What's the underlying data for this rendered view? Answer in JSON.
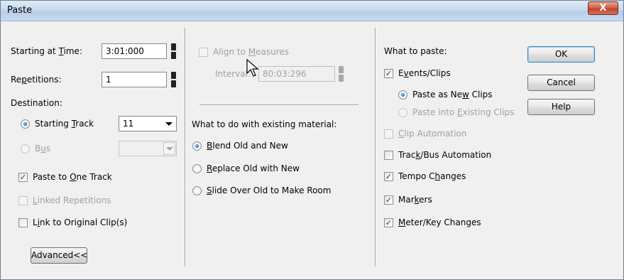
{
  "window": {
    "title": "Paste",
    "close_glyph": "X"
  },
  "left": {
    "starting_time": {
      "label_pre": "Starting at ",
      "label_key": "T",
      "label_post": "ime:",
      "value": "3:01:000"
    },
    "repetitions": {
      "label_pre": "Re",
      "label_key": "p",
      "label_post": "etitions:",
      "value": "1"
    },
    "destination_label": "Destination:",
    "starting_track": {
      "label_pre": "Starting ",
      "label_key": "T",
      "label_post": "rack",
      "value": "11"
    },
    "bus": {
      "label_pre": "B",
      "label_key": "u",
      "label_post": "s",
      "value": ""
    },
    "paste_one_track": {
      "label_pre": "Paste to ",
      "label_key": "O",
      "label_post": "ne Track"
    },
    "linked_reps": {
      "label_pre": "",
      "label_key": "L",
      "label_post": "inked Repetitions"
    },
    "link_original": {
      "label_pre": "L",
      "label_key": "i",
      "label_post": "nk to Original Clip(s)"
    },
    "advanced_button": "Advanced<<"
  },
  "middle": {
    "align_measures": {
      "label_pre": "Align to ",
      "label_key": "M",
      "label_post": "easures"
    },
    "interval": {
      "label": "Interval:",
      "value": "80:03:296"
    },
    "existing_heading": "What to do with existing material:",
    "blend": {
      "label_pre": "",
      "label_key": "B",
      "label_post": "lend Old and New"
    },
    "replace": {
      "label_pre": "",
      "label_key": "R",
      "label_post": "eplace Old with New"
    },
    "slide": {
      "label_pre": "",
      "label_key": "S",
      "label_post": "lide Over Old to Make Room"
    }
  },
  "right": {
    "heading": "What to paste:",
    "events_clips": {
      "label_pre": "E",
      "label_key": "v",
      "label_post": "ents/Clips"
    },
    "paste_new_clips": {
      "label_pre": "Paste as Ne",
      "label_key": "w",
      "label_post": " Clips"
    },
    "paste_existing_clips": {
      "label_pre": "Paste into ",
      "label_key": "E",
      "label_post": "xisting Clips"
    },
    "clip_automation": {
      "label_pre": "",
      "label_key": "C",
      "label_post": "lip Automation"
    },
    "track_bus_automation": {
      "label_pre": "Trac",
      "label_key": "k",
      "label_post": "/Bus Automation"
    },
    "tempo_changes": {
      "label_pre": "Tempo C",
      "label_key": "h",
      "label_post": "anges"
    },
    "markers": {
      "label_pre": "Mar",
      "label_key": "k",
      "label_post": "ers"
    },
    "meter_key": {
      "label_pre": "",
      "label_key": "M",
      "label_post": "eter/Key Changes"
    },
    "ok_button": "OK",
    "cancel_button": "Cancel",
    "help_button": "Help"
  },
  "check_glyph": "✓",
  "colors": {
    "accent": "#1c5bb5",
    "close": "#c1412a",
    "disabled_text": "#a0a0a0"
  }
}
